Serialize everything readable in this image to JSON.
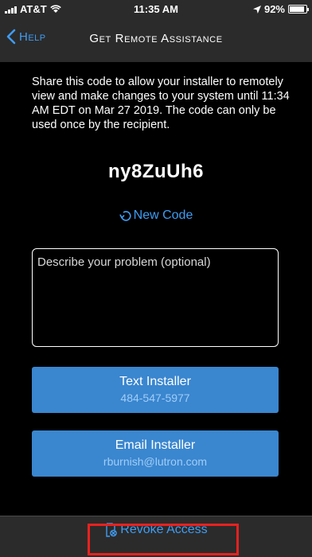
{
  "status_bar": {
    "carrier": "AT&T",
    "time": "11:35 AM",
    "battery": "92%",
    "battery_level": 0.92
  },
  "nav": {
    "back_label": "Help",
    "title": "Get Remote Assistance"
  },
  "content": {
    "info_text": "Share this code to allow your installer to remotely view and make changes to your system until 11:34 AM EDT on Mar 27 2019. The code can only be used once by the recipient.",
    "code": "ny8ZuUh6",
    "new_code_label": "New Code",
    "problem_placeholder": "Describe your problem (optional)",
    "problem_value": ""
  },
  "buttons": {
    "text_installer": {
      "label": "Text Installer",
      "detail": "484-547-5977"
    },
    "email_installer": {
      "label": "Email Installer",
      "detail": "rburnish@lutron.com"
    }
  },
  "bottom": {
    "revoke_label": "Revoke Access"
  },
  "colors": {
    "accent": "#3f9cf2",
    "button": "#3a86cf",
    "highlight": "#e8211f",
    "bar": "#2b2b2b"
  },
  "icons": [
    "signal-icon",
    "wifi-icon",
    "location-arrow-icon",
    "battery-icon",
    "back-chevron-icon",
    "refresh-icon",
    "revoke-icon"
  ]
}
